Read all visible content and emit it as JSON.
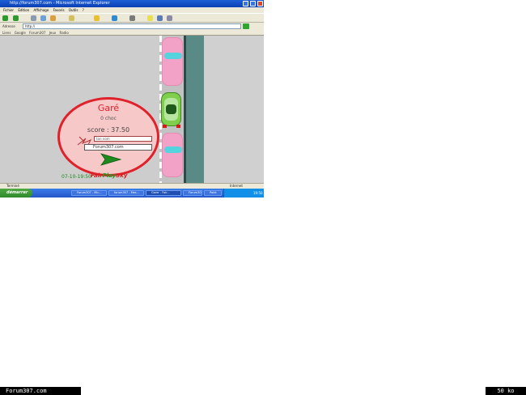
{
  "browser": {
    "title": "http://forum307.com - Microsoft Internet Explorer",
    "menu": [
      "Fichier",
      "Edition",
      "Affichage",
      "Favoris",
      "Outils",
      "?"
    ],
    "address_label": "Adresse",
    "address_value": "http://",
    "links_label": "Liens",
    "links": [
      "Google",
      "Forum307",
      "Jeux",
      "Radio"
    ]
  },
  "game": {
    "result_title": "Garé",
    "result_subtitle": "0 choc",
    "score_text": "score : 37.50",
    "pseudo_value": "ton nom",
    "site_value": "Forum307.com",
    "timestamp": "07-10-19:50",
    "logo_part1": "Fair",
    "logo_part2": "Play",
    "logo_part3": "Sky"
  },
  "statusbar": {
    "status": "Terminé",
    "zone": "Internet"
  },
  "taskbar": {
    "start_label": "démarrer",
    "tasks": [
      "Forum307 - Mic...",
      "forum307 - Mes...",
      "Garer - Fair...",
      "Forum307 jeu...",
      "Paint"
    ],
    "clock": "19:50"
  },
  "footer": {
    "site": "Forum307.com",
    "size": "50 ko"
  },
  "colors": {
    "bubble_border": "#e0202a",
    "bubble_fill": "#f7c8c8",
    "parked_car": "#f1a2c6",
    "player_car": "#7fce4c",
    "road": "#5a8a86"
  }
}
